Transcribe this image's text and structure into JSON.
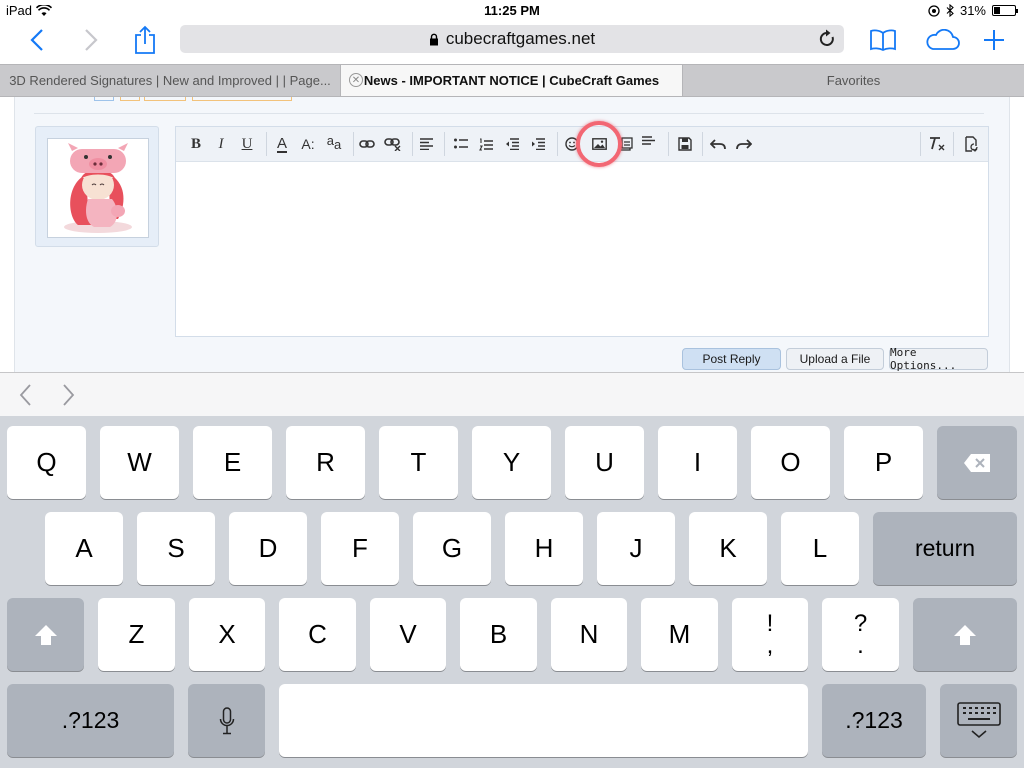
{
  "status_bar": {
    "device": "iPad",
    "time": "11:25 PM",
    "battery": "31%",
    "battery_level": 0.31
  },
  "browser": {
    "url": "cubecraftgames.net",
    "tabs": [
      {
        "label": "3D Rendered Signatures | New and Improved | | Page..."
      },
      {
        "label": "News - IMPORTANT NOTICE | CubeCraft Games",
        "active": true
      },
      {
        "label": "Favorites"
      }
    ]
  },
  "editor": {
    "toolbar": {
      "bold": "B",
      "italic": "I",
      "underline": "U",
      "text_color": "A",
      "font_size": "A:",
      "font_family": "a",
      "font_family_sub": "a"
    },
    "highlighted_tool": "image-icon"
  },
  "post_actions": {
    "post_reply": "Post Reply",
    "upload_file": "Upload a File",
    "more_options": "More Options..."
  },
  "keyboard": {
    "row1": [
      "Q",
      "W",
      "E",
      "R",
      "T",
      "Y",
      "U",
      "I",
      "O",
      "P"
    ],
    "row2": [
      "A",
      "S",
      "D",
      "F",
      "G",
      "H",
      "J",
      "K",
      "L"
    ],
    "return_label": "return",
    "row3": [
      "Z",
      "X",
      "C",
      "V",
      "B",
      "N",
      "M"
    ],
    "punct1": {
      "top": "!",
      "bottom": ","
    },
    "punct2": {
      "top": "?",
      "bottom": "."
    },
    "numbers_label": ".?123"
  },
  "colors": {
    "accent": "#1479f6",
    "highlight_ring": "#f26773",
    "keyboard_bg": "#d1d5db"
  }
}
